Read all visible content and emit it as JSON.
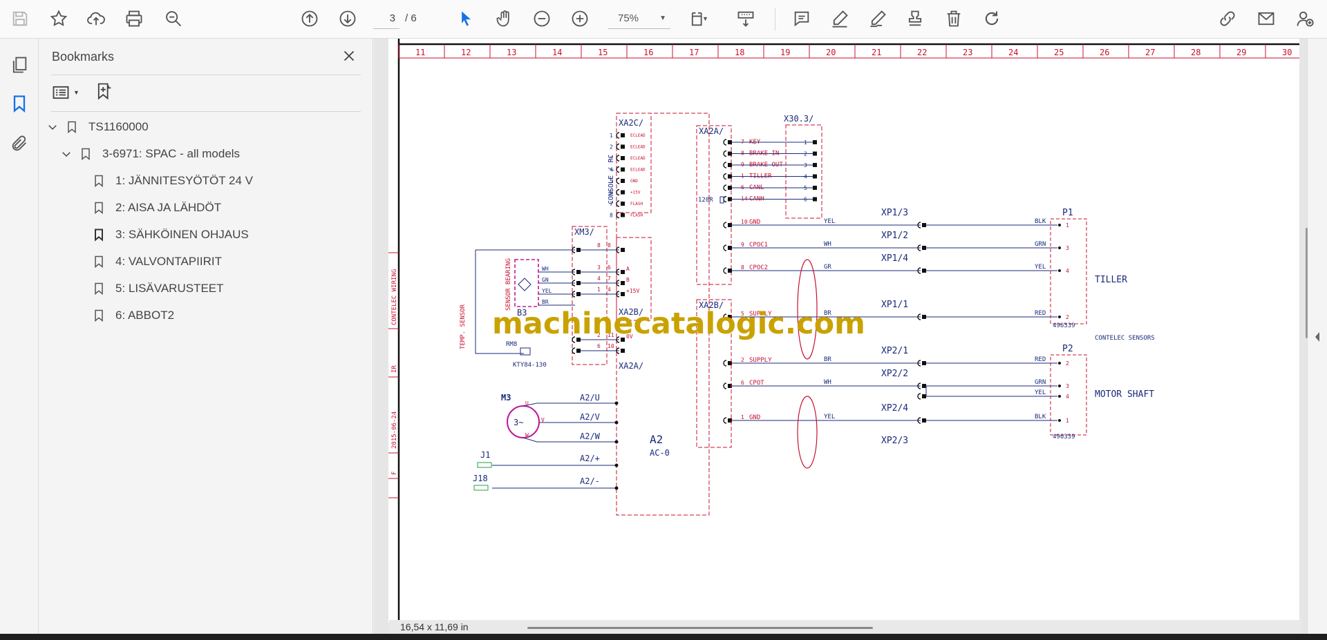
{
  "toolbar": {
    "current_page": "3",
    "total_pages": "/ 6",
    "zoom": "75%",
    "icons": [
      "save-icon",
      "bookmark-star-icon",
      "upload-icon",
      "print-icon",
      "search-zoom-icon",
      "prev-page-icon",
      "next-page-icon",
      "select-cursor-icon",
      "hand-icon",
      "zoom-out-icon",
      "zoom-in-icon",
      "fit-page-icon",
      "scroll-mode-icon",
      "comment-icon",
      "highlight-icon",
      "draw-icon",
      "stamp-icon",
      "delete-icon",
      "rotate-icon",
      "share-link-icon",
      "email-icon",
      "add-user-icon"
    ]
  },
  "leftrail": {
    "icons": [
      "pages-icon",
      "bookmarks-icon",
      "attachments-icon"
    ]
  },
  "bookmarks": {
    "title": "Bookmarks",
    "root": "TS1160000",
    "child": "3-6971: SPAC - all models",
    "items": [
      "1: JÄNNITESYÖTÖT 24 V",
      "2: AISA JA LÄHDÖT",
      "3: SÄHKÖINEN OHJAUS",
      "4: VALVONTAPIIRIT",
      "5: LISÄVARUSTEET",
      "6: ABBOT2"
    ]
  },
  "schematic": {
    "ruler": [
      "11",
      "12",
      "13",
      "14",
      "15",
      "16",
      "17",
      "18",
      "19",
      "20",
      "21",
      "22",
      "23",
      "24",
      "25",
      "26",
      "27",
      "28",
      "29",
      "30"
    ],
    "left_margin": [
      "CONTELEC WIRING",
      "IR",
      "2015-06-24",
      "F"
    ],
    "xa2c": {
      "label": "XA2C/",
      "pins": [
        "1",
        "2",
        "3",
        "4",
        "5",
        "6",
        "7",
        "8"
      ],
      "pin_names": [
        "ECLEAD",
        "ECLEAD",
        "ECLEAD",
        "ECLEAD",
        "GND",
        "+15V",
        "FLASH",
        "FLASH"
      ],
      "side": "CONSOLE / PC"
    },
    "xa2a_top": {
      "label": "XA2A/",
      "pins": [
        "7",
        "8",
        "9",
        "1",
        "6",
        "14"
      ],
      "names": [
        "KEY",
        "BRAKE IN",
        "BRAKE OUT",
        "TILLER",
        "CANL",
        "CANH"
      ]
    },
    "x30": {
      "label": "X30.3/",
      "pins": [
        "1",
        "2",
        "3",
        "4",
        "5",
        "6"
      ]
    },
    "resistor": "120R",
    "gnd_pin": "10",
    "gnd": "GND",
    "cpoc1": {
      "pin": "9",
      "name": "CPOC1",
      "wire": "WH"
    },
    "cpoc2": {
      "pin": "8",
      "name": "CPOC2",
      "wire": "GR"
    },
    "yel": "YEL",
    "xp1_3": "XP1/3",
    "xp1_2": "XP1/2",
    "xp1_4": "XP1/4",
    "xp1_1": "XP1/1",
    "xp2_1": "XP2/1",
    "xp2_2": "XP2/2",
    "xp2_4": "XP2/4",
    "xp2_3": "XP2/3",
    "xa2b": {
      "label": "XA2B/",
      "supply_pin": "5",
      "supply": "SUPPLY",
      "supply_wire": "BR"
    },
    "p1": {
      "label": "P1",
      "pins": [
        "1",
        "3",
        "4",
        "2"
      ],
      "colors": [
        "BLK",
        "GRN",
        "YEL",
        "RED"
      ],
      "part": "496339",
      "name": "TILLER"
    },
    "sensors_label": "CONTELEC SENSORS",
    "p2": {
      "label": "P2",
      "pins": [
        "2",
        "3",
        "4",
        "1"
      ],
      "colors": [
        "RED",
        "GRN",
        "YEL",
        "BLK"
      ],
      "part": "496339",
      "name": "MOTOR SHAFT"
    },
    "xa2b_lower": {
      "supply_pin": "2",
      "supply": "SUPPLY",
      "supply_wire": "BR",
      "cpot_pin": "6",
      "cpot": "CPOT",
      "cpot_wire": "WH",
      "gnd_pin": "1",
      "gnd": "GND",
      "gnd_wire": "YEL"
    },
    "xm3": {
      "label": "XM3/",
      "pins": [
        "8",
        "3",
        "4",
        "1",
        "2",
        "6"
      ]
    },
    "xa2b_mid": {
      "label": "XA2B/",
      "pins": [
        "8",
        "6",
        "7",
        "4",
        "11",
        "10"
      ],
      "names": [
        "",
        "A",
        "B",
        "+15V",
        "0V",
        ""
      ]
    },
    "xa2a_bottom": "XA2A/",
    "sensor_bearing": "SENSOR BEARING",
    "bearing_wires": [
      "WH",
      "GN",
      "YEL",
      "BR"
    ],
    "b3": "B3",
    "temp_sensor": "TEMP. SENSOR",
    "rm8": "RM8",
    "kty": "KTY84-130",
    "m3": {
      "label": "M3",
      "symbol": "3~",
      "phases": [
        "U",
        "V",
        "W"
      ]
    },
    "a2_terms": [
      "A2/U",
      "A2/V",
      "A2/W",
      "A2/+",
      "A2/-"
    ],
    "a2": "A2",
    "ac0": "AC-0",
    "j1": "J1",
    "j18": "J18"
  },
  "watermark": "machinecatalogic.com",
  "status": {
    "page_size": "16,54 x 11,69 in"
  },
  "colors": {
    "accent": "#1473e6",
    "schematic_red": "#c8102e",
    "schematic_blue": "#1a2a7a",
    "magenta": "#c0189a",
    "watermark": "#c9a200"
  }
}
